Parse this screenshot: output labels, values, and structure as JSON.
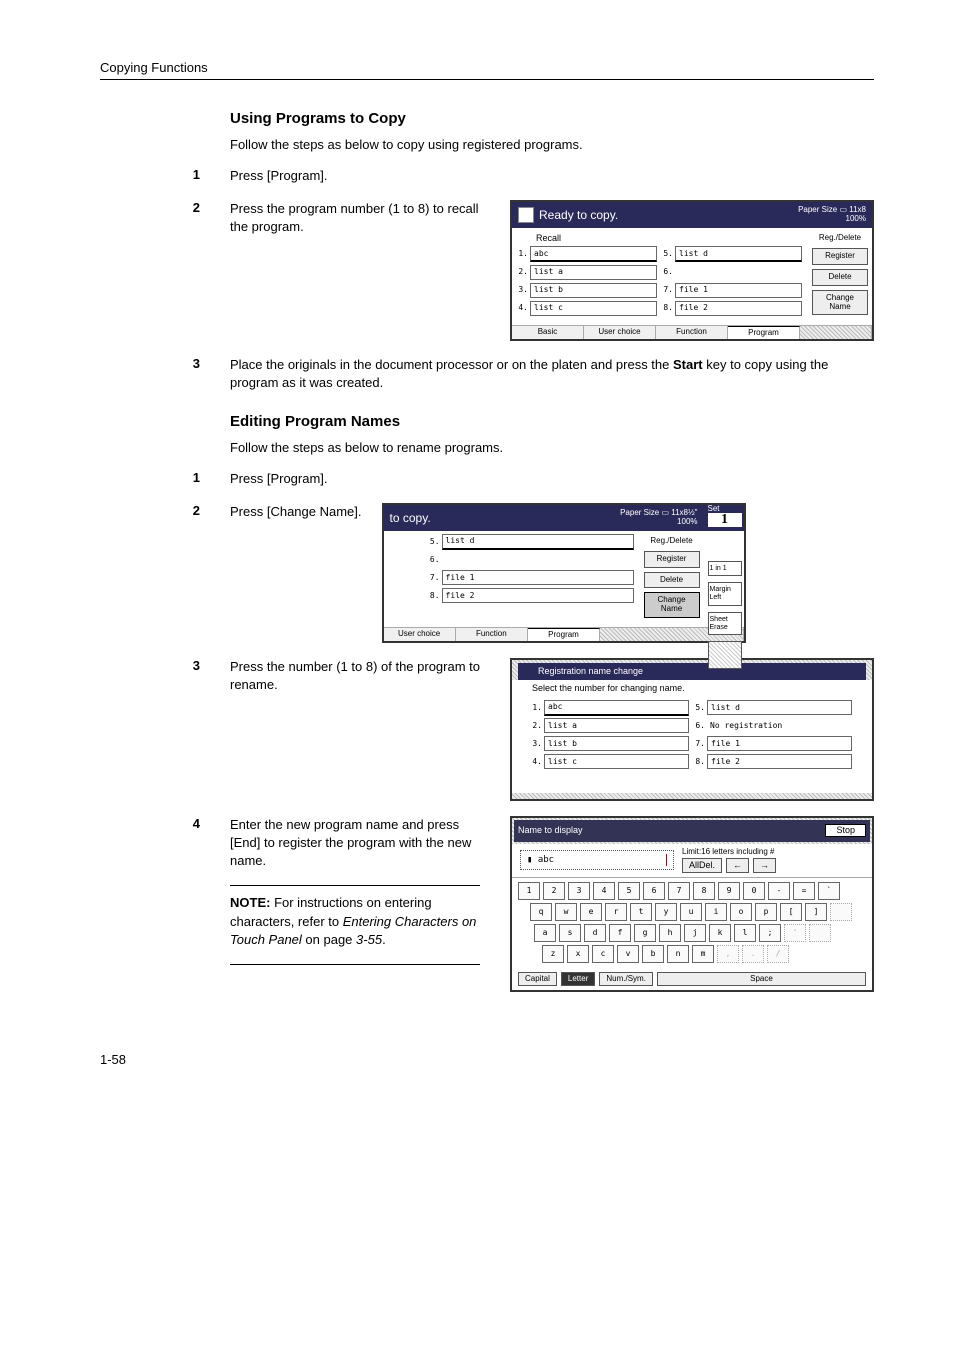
{
  "header": "Copying Functions",
  "section1": {
    "title": "Using Programs to Copy",
    "intro": "Follow the steps as below to copy using registered programs.",
    "steps": {
      "s1": "Press [Program].",
      "s2": "Press the program number (1 to 8) to recall the program.",
      "s3_a": "Place the originals in the document processor or on the platen and press the ",
      "s3_b": "Start",
      "s3_c": " key to copy using the program as it was created."
    }
  },
  "section2": {
    "title": "Editing Program Names",
    "intro": "Follow the steps as below to rename programs.",
    "steps": {
      "s1": "Press [Program].",
      "s2": "Press [Change Name].",
      "s3": "Press the number (1 to 8) of the program to rename.",
      "s4": "Enter the new program name and press [End] to register the program with the new name.",
      "note_label": "NOTE:",
      "note_a": " For instructions on entering characters, refer to ",
      "note_b": "Entering Characters on Touch Panel",
      "note_c": " on page ",
      "note_d": "3-55",
      "note_e": "."
    }
  },
  "screen1": {
    "title": "Ready to copy.",
    "paper_label": "Paper Size",
    "paper_size": "11x8",
    "zoom": "100%",
    "recall": "Recall",
    "progs": [
      "abc",
      "list a",
      "list b",
      "list c",
      "list d",
      "",
      "file 1",
      "file 2"
    ],
    "side": {
      "rd": "Reg./Delete",
      "reg": "Register",
      "del": "Delete",
      "cn": "Change Name"
    },
    "tabs": [
      "Basic",
      "User choice",
      "Function",
      "Program"
    ]
  },
  "screen2": {
    "title": "to copy.",
    "paper_label": "Paper Size",
    "paper_size": "11x8½\"",
    "zoom": "100%",
    "set_label": "Set",
    "set_num": "1",
    "progs": [
      "list d",
      "",
      "file 1",
      "file 2"
    ],
    "side": {
      "rd": "Reg./Delete",
      "reg": "Register",
      "del": "Delete",
      "cn": "Change Name"
    },
    "quick": [
      "1 in 1",
      "Margin Left",
      "Sheet Erase"
    ],
    "tabs": [
      "User choice",
      "Function",
      "Program"
    ]
  },
  "screen3": {
    "title": "Registration name change",
    "subtitle": "Select the number for changing name.",
    "progs_l": [
      "abc",
      "list a",
      "list b",
      "list c"
    ],
    "progs_r": [
      "list d",
      "No registration",
      "file 1",
      "file 2"
    ]
  },
  "screen4": {
    "title": "Name to display",
    "stop": "Stop",
    "value": "abc",
    "limit": "Limit:16 letters including #",
    "alldel": "AllDel.",
    "left": "←",
    "right": "→",
    "row1": [
      "1",
      "2",
      "3",
      "4",
      "5",
      "6",
      "7",
      "8",
      "9",
      "0",
      "-",
      "=",
      "`"
    ],
    "row2": [
      "q",
      "w",
      "e",
      "r",
      "t",
      "y",
      "u",
      "i",
      "o",
      "p",
      "[",
      "]",
      ""
    ],
    "row3": [
      "a",
      "s",
      "d",
      "f",
      "g",
      "h",
      "j",
      "k",
      "l",
      ";",
      "'",
      ""
    ],
    "row4": [
      "z",
      "x",
      "c",
      "v",
      "b",
      "n",
      "m",
      ",",
      ".",
      "/"
    ],
    "modes": {
      "cap": "Capital",
      "let": "Letter",
      "num": "Num./Sym.",
      "space": "Space"
    }
  },
  "page_num": "1-58"
}
